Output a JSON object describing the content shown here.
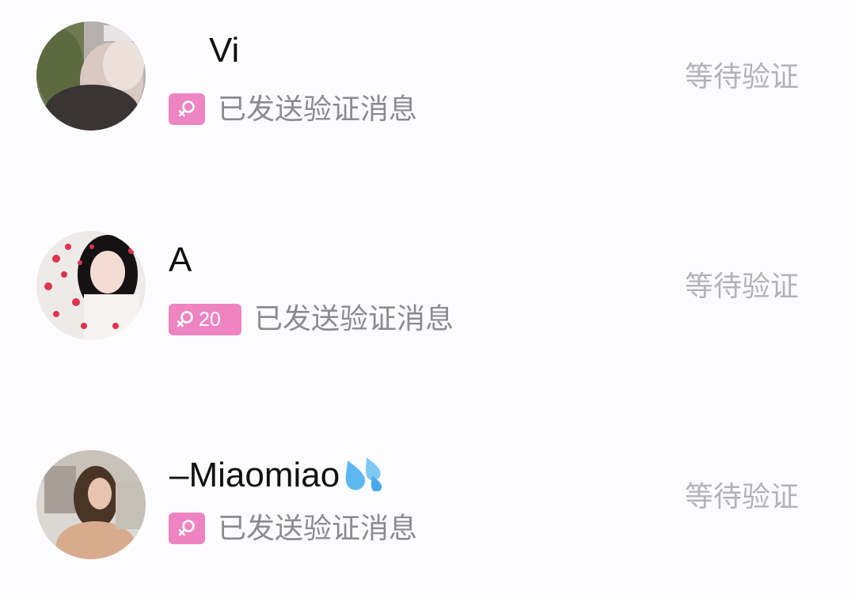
{
  "accent_color": "#ee84c2",
  "requests": [
    {
      "name": "Vi",
      "badge_icon": "female-icon",
      "badge_age": "",
      "subtitle": "已发送验证消息",
      "status": "等待验证"
    },
    {
      "name": "A",
      "badge_icon": "female-icon",
      "badge_age": "20",
      "subtitle": "已发送验证消息",
      "status": "等待验证"
    },
    {
      "name": "–Miaomiao",
      "name_emoji": "sweat-droplets-emoji",
      "badge_icon": "female-icon",
      "badge_age": "",
      "subtitle": "已发送验证消息",
      "status": "等待验证"
    }
  ]
}
